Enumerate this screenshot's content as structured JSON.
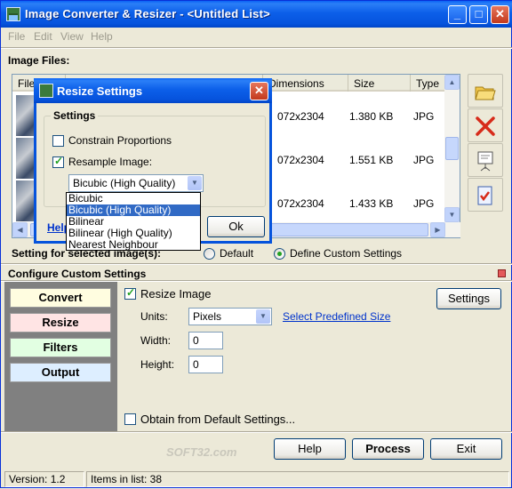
{
  "window": {
    "title": "Image Converter & Resizer - <Untitled List>"
  },
  "menu": [
    "File",
    "Edit",
    "View",
    "Help"
  ],
  "image_files_label": "Image Files:",
  "columns": [
    "File",
    "Dimensions",
    "Size",
    "Type"
  ],
  "rows": [
    {
      "dimensions": "072x2304",
      "size": "1.380 KB",
      "type": "JPG"
    },
    {
      "dimensions": "072x2304",
      "size": "1.551 KB",
      "type": "JPG"
    },
    {
      "dimensions": "072x2304",
      "size": "1.433 KB",
      "type": "JPG"
    }
  ],
  "setting_label": "Setting for selected image(s):",
  "radio_default": "Default",
  "radio_custom": "Define Custom Settings",
  "configure_label": "Configure Custom Settings",
  "tabs": [
    {
      "label": "Convert",
      "color": "#fffde0"
    },
    {
      "label": "Resize",
      "color": "#ffe4e4"
    },
    {
      "label": "Filters",
      "color": "#e2ffe2"
    },
    {
      "label": "Output",
      "color": "#ddeeff"
    }
  ],
  "resize": {
    "resize_image_label": "Resize Image",
    "settings_button": "Settings",
    "units_label": "Units:",
    "units_value": "Pixels",
    "predefined_link": "Select Predefined Size",
    "width_label": "Width:",
    "width_value": "0",
    "height_label": "Height:",
    "height_value": "0",
    "obtain_label": "Obtain from Default Settings..."
  },
  "buttons": {
    "help": "Help",
    "process": "Process",
    "exit": "Exit"
  },
  "status": {
    "version": "Version: 1.2",
    "items": "Items in list: 38"
  },
  "watermark": "SOFT32.com",
  "dialog": {
    "title": "Resize Settings",
    "group": "Settings",
    "constrain": "Constrain Proportions",
    "resample": "Resample Image:",
    "selected": "Bicubic (High Quality)",
    "options": [
      "Bicubic",
      "Bicubic (High Quality)",
      "Bilinear",
      "Bilinear (High Quality)",
      "Nearest Neighbour"
    ],
    "help_link": "Help",
    "ok": "Ok"
  }
}
